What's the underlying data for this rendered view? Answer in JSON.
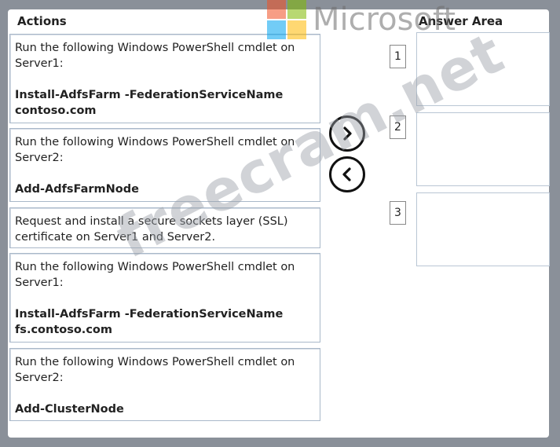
{
  "headers": {
    "actions": "Actions",
    "answer_area": "Answer Area"
  },
  "actions": [
    {
      "text": "Run the following Windows PowerShell cmdlet on Server1:",
      "cmd": "Install-AdfsFarm -FederationServiceName contoso.com"
    },
    {
      "text": "Run the following Windows PowerShell cmdlet on Server2:",
      "cmd": "Add-AdfsFarmNode"
    },
    {
      "text": "Request and install a secure sockets layer (SSL) certificate on Server1 and Server2.",
      "cmd": ""
    },
    {
      "text": "Run the following Windows PowerShell cmdlet on Server1:",
      "cmd": "Install-AdfsFarm -FederationServiceName fs.contoso.com"
    },
    {
      "text": "Run the following Windows PowerShell cmdlet on Server2:",
      "cmd": "Add-ClusterNode"
    }
  ],
  "answer_slots": [
    "1",
    "2",
    "3"
  ],
  "buttons": {
    "move_right_icon": "chevron-right-icon",
    "move_left_icon": "chevron-left-icon"
  },
  "watermarks": {
    "brand": "Microsoft",
    "site": "freecram.net"
  },
  "colors": {
    "background": "#8a9099",
    "panel": "#ffffff",
    "border": "#a9b8c9",
    "ms_red": "#f25022",
    "ms_green": "#7fba00",
    "ms_blue": "#00a4ef",
    "ms_yellow": "#ffb900"
  }
}
